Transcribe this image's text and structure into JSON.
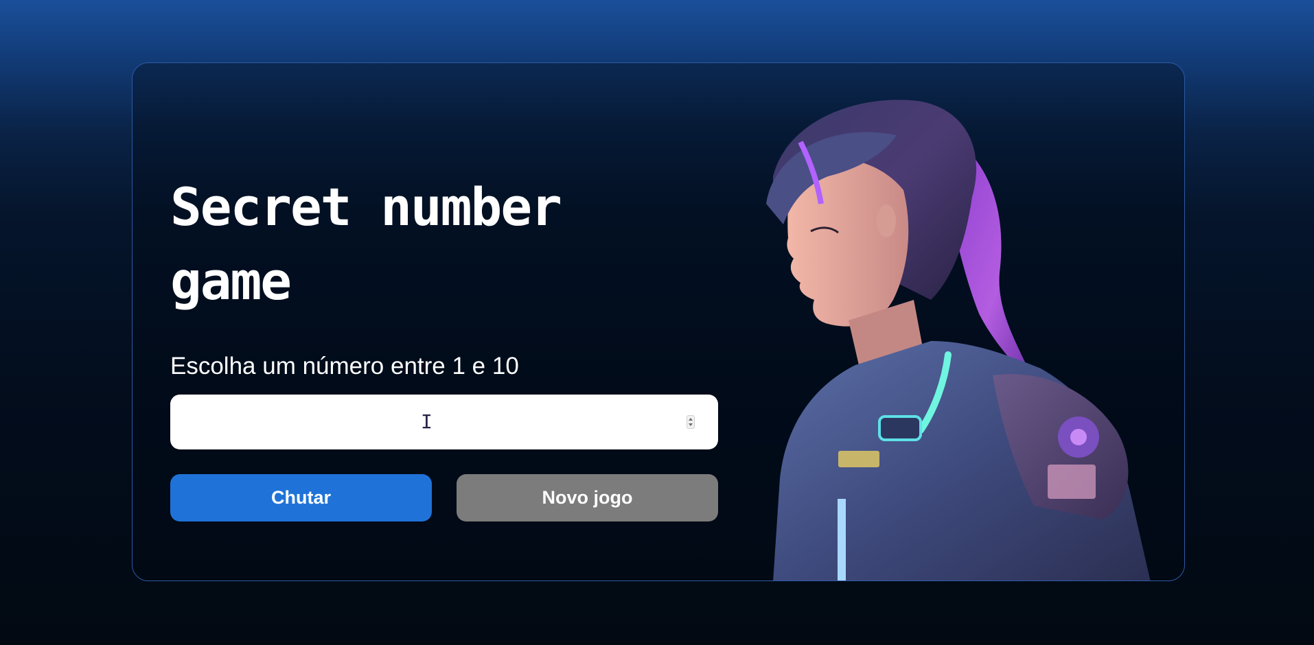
{
  "game": {
    "title": "Secret number game",
    "instruction": "Escolha um número entre 1 e 10",
    "guess_value": "",
    "guess_button_label": "Chutar",
    "new_game_button_label": "Novo jogo"
  },
  "colors": {
    "primary_button": "#1f73d8",
    "secondary_button": "#7c7c7c",
    "card_border": "#2c5aa6",
    "text": "#ffffff"
  },
  "icons": {
    "text_cursor": "I"
  }
}
